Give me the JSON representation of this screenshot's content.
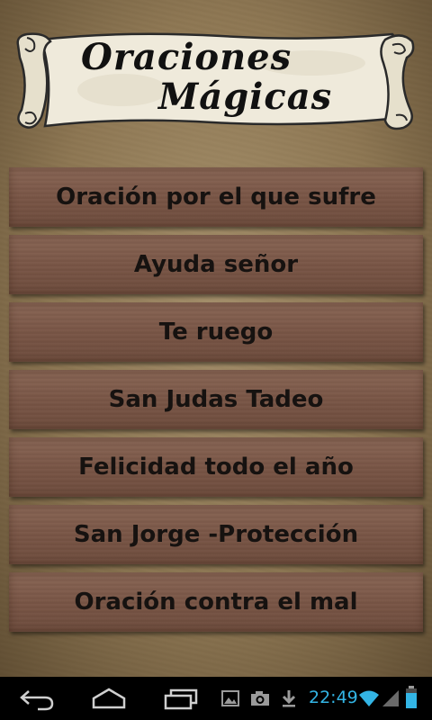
{
  "app": {
    "title_line1": "Oraciones",
    "title_line2": "Mágicas"
  },
  "prayers": [
    {
      "label": "Oración por el que sufre"
    },
    {
      "label": "Ayuda señor"
    },
    {
      "label": "Te ruego"
    },
    {
      "label": "San Judas Tadeo"
    },
    {
      "label": "Felicidad todo el año"
    },
    {
      "label": "San Jorge -Protección"
    },
    {
      "label": "Oración contra el mal"
    }
  ],
  "status_bar": {
    "time": "22:49",
    "icons": [
      "gallery-icon",
      "camera-icon",
      "download-icon",
      "wifi-icon",
      "signal-icon",
      "battery-icon"
    ]
  },
  "navigation": {
    "buttons": [
      "back-icon",
      "home-icon",
      "recent-apps-icon"
    ]
  },
  "colors": {
    "background": "#8e7753",
    "button": "#7a5646",
    "button_text": "#161210",
    "clock": "#33b5e5"
  }
}
